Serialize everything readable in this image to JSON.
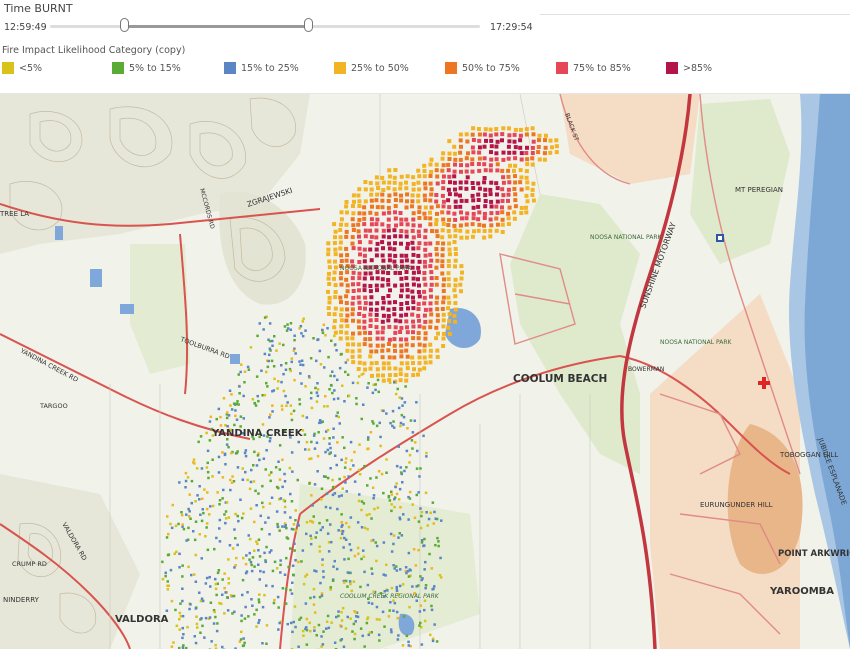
{
  "time": {
    "title": "Time BURNT",
    "start": "12:59:49",
    "end": "17:29:54"
  },
  "legend": {
    "title": "Fire Impact Likelihood Category (copy)",
    "items": [
      {
        "label": "<5%",
        "color": "#d9c21a"
      },
      {
        "label": "5% to 15%",
        "color": "#5aab36"
      },
      {
        "label": "15% to 25%",
        "color": "#5b86c6"
      },
      {
        "label": "25% to 50%",
        "color": "#f2b424"
      },
      {
        "label": "50% to 75%",
        "color": "#ed7622"
      },
      {
        "label": "75% to 85%",
        "color": "#e54758"
      },
      {
        "label": ">85%",
        "color": "#b3154a"
      }
    ]
  },
  "map": {
    "labels": {
      "coolum_beach": "COOLUM BEACH",
      "yandina_creek": "YANDINA CREEK",
      "valdora": "VALDORA",
      "yaroomba": "YAROOMBA",
      "point_arkwright": "POINT ARKWRIGHT",
      "noosa_np": "NOOSA NATIONAL PARK",
      "sunshine_motorway": "SUNSHINE MOTORWAY",
      "mt_peregian": "MT PEREGIAN",
      "toboggan_hill": "TOBOGGAN HILL",
      "eurungunder_hill": "EURUNGUNDER HILL",
      "coolum_creek_rp": "COOLUM CREEK REGIONAL PARK",
      "jubilee_esplanade": "JUBILEE ESPLANADE",
      "zgrajewski": "ZGRAJEWSKI",
      "yandina_creek_rd": "YANDINA CREEK RD",
      "valdora_rd": "VALDORA RD",
      "crump_rd": "CRUMP RD",
      "ninderry": "NINDERRY",
      "targoo": "TARGOO",
      "toolburra": "TOOLBURRA RD",
      "mccords": "MCCORDS RD",
      "tree_la": "TREE LA",
      "bowerman": "BOWERMAN",
      "black_st": "BLACK ST"
    }
  }
}
